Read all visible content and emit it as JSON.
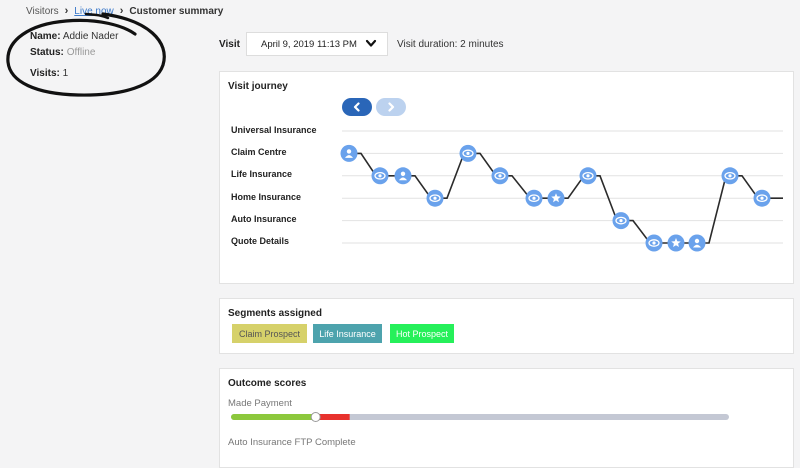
{
  "breadcrumb": [
    "Visitors",
    "Live now",
    "Customer summary"
  ],
  "customer": {
    "name_label": "Name:",
    "name": "Addie Nader",
    "status_label": "Status:",
    "status": "Offline",
    "visits_label": "Visits:",
    "visits": "1"
  },
  "visit": {
    "label": "Visit",
    "selected": "April 9, 2019 11:13 PM",
    "duration": "Visit duration: 2 minutes"
  },
  "journey": {
    "title": "Visit journey",
    "rows": [
      "Universal Insurance",
      "Claim Centre",
      "Life Insurance",
      "Home Insurance",
      "Auto Insurance",
      "Quote Details"
    ],
    "steps": [
      {
        "row": 1,
        "icon": "person-icon"
      },
      {
        "row": 2,
        "icon": "eye-icon"
      },
      {
        "row": 2,
        "icon": "person-icon"
      },
      {
        "row": 3,
        "icon": "eye-icon"
      },
      {
        "row": 1,
        "icon": "eye-icon"
      },
      {
        "row": 2,
        "icon": "eye-icon"
      },
      {
        "row": 3,
        "icon": "eye-icon"
      },
      {
        "row": 3,
        "icon": "star-icon"
      },
      {
        "row": 2,
        "icon": "eye-icon"
      },
      {
        "row": 4,
        "icon": "eye-icon"
      },
      {
        "row": 5,
        "icon": "eye-icon"
      },
      {
        "row": 5,
        "icon": "star-icon"
      },
      {
        "row": 5,
        "icon": "person-icon"
      },
      {
        "row": 2,
        "icon": "eye-icon"
      },
      {
        "row": 3,
        "icon": "eye-icon"
      }
    ],
    "colors": {
      "node": "#6aa2ec",
      "line": "#2b2b2b",
      "grid": "#e2e2e2"
    }
  },
  "segments": {
    "title": "Segments assigned",
    "items": [
      {
        "label": "Claim Prospect",
        "bg": "#d6d16a",
        "fg": "#555555"
      },
      {
        "label": "Life Insurance",
        "bg": "#4da3ad",
        "fg": "#ffffff"
      },
      {
        "label": "Hot Prospect",
        "bg": "#26f05a",
        "fg": "#ffffff"
      }
    ]
  },
  "outcomes": {
    "title": "Outcome scores",
    "items": [
      {
        "label": "Made Payment",
        "value_pct": 17
      },
      {
        "label": "Auto Insurance FTP Complete"
      }
    ],
    "colors": {
      "good": "#8cc83c",
      "bad": "#e8322d",
      "track": "#c4c8d4"
    }
  }
}
